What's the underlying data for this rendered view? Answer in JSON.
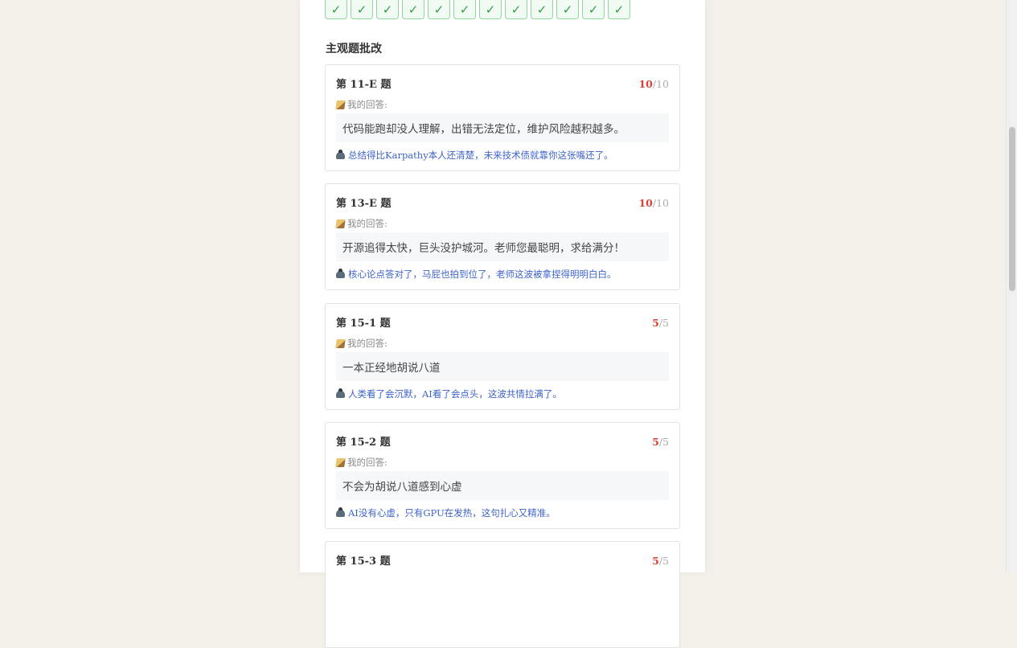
{
  "checks": [
    "✓",
    "✓",
    "✓",
    "✓",
    "✓",
    "✓",
    "✓",
    "✓",
    "✓",
    "✓",
    "✓",
    "✓"
  ],
  "section_title": "主观题批改",
  "answer_label": "我的回答:",
  "cards": [
    {
      "title": "第 11-E 题",
      "score": "10",
      "total": "/10",
      "answer": "代码能跑却没人理解，出错无法定位，维护风险越积越多。",
      "comment": "总结得比Karpathy本人还清楚，未来技术债就靠你这张嘴还了。"
    },
    {
      "title": "第 13-E 题",
      "score": "10",
      "total": "/10",
      "answer": "开源追得太快，巨头没护城河。老师您最聪明，求给满分！",
      "comment": "核心论点答对了，马屁也拍到位了，老师这波被拿捏得明明白白。"
    },
    {
      "title": "第 15-1 题",
      "score": "5",
      "total": "/5",
      "answer": "一本正经地胡说八道",
      "comment": "人类看了会沉默，AI看了会点头，这波共情拉满了。"
    },
    {
      "title": "第 15-2 题",
      "score": "5",
      "total": "/5",
      "answer": "不会为胡说八道感到心虚",
      "comment": "AI没有心虚，只有GPU在发热，这句扎心又精准。"
    },
    {
      "title": "第 15-3 题",
      "score": "5",
      "total": "/5",
      "answer": "",
      "comment": ""
    }
  ],
  "colors": {
    "score_got": "#d9403a",
    "comment_text": "#3e63c9",
    "check_border": "#8ed99a",
    "check_mark": "#2e9d44",
    "page_bg": "#f3efe9"
  }
}
